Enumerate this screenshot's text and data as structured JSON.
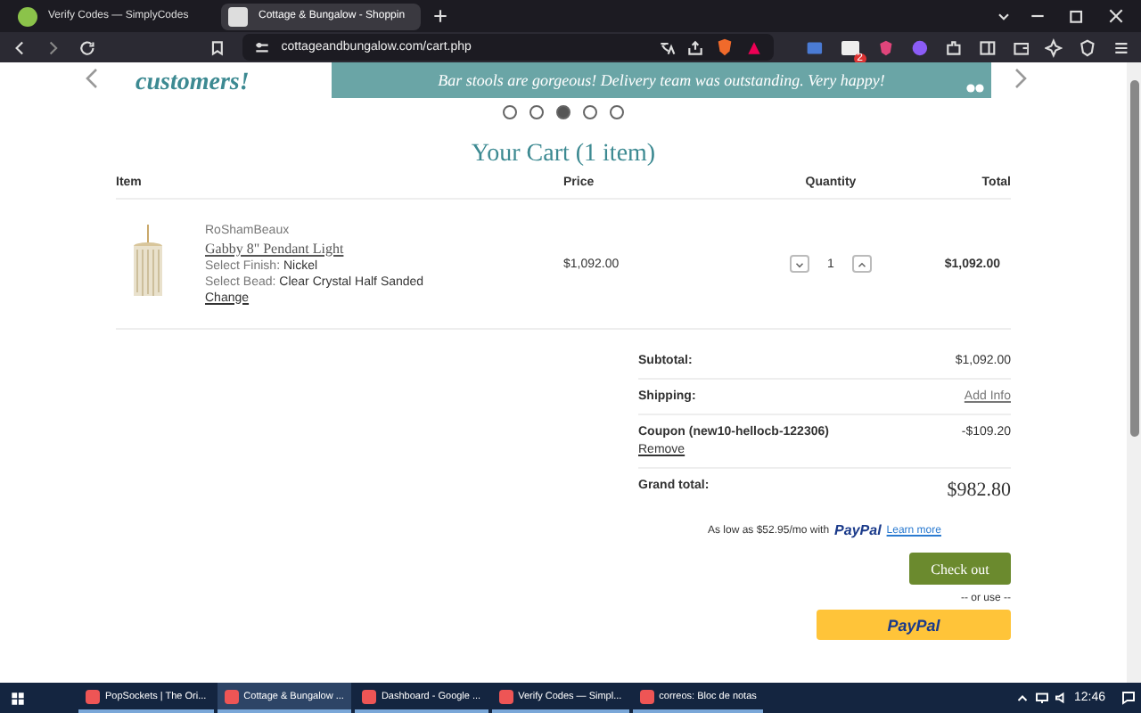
{
  "browser": {
    "tabs": [
      {
        "title": "Verify Codes — SimplyCodes",
        "selected": false
      },
      {
        "title": "Cottage & Bungalow - Shoppin",
        "selected": true
      }
    ],
    "url": "cottageandbungalow.com/cart.php",
    "extension_badge": "2"
  },
  "testimonial": {
    "tagline": "customers!",
    "quote": "Bar stools are gorgeous! Delivery team was outstanding. Very happy!"
  },
  "carousel_dots": [
    {
      "selected": false
    },
    {
      "selected": false
    },
    {
      "selected": true
    },
    {
      "selected": false
    },
    {
      "selected": false
    }
  ],
  "cart": {
    "title": "Your Cart (1 item)",
    "columns": [
      "Item",
      "Price",
      "Quantity",
      "Total"
    ],
    "items": [
      {
        "brand": "RoShamBeaux",
        "name": "Gabby 8\" Pendant Light",
        "options": [
          {
            "label": "Select Finish:",
            "value": "Nickel"
          },
          {
            "label": "Select Bead:",
            "value": "Clear Crystal Half Sanded"
          }
        ],
        "change": "Change",
        "price": "$1,092.00",
        "quantity": "1",
        "total": "$1,092.00"
      }
    ]
  },
  "summary": [
    {
      "kind": "plain",
      "label": "Subtotal:",
      "value": "$1,092.00"
    },
    {
      "kind": "link",
      "label": "Shipping:",
      "value": "Add Info"
    },
    {
      "kind": "coupon",
      "label": "Coupon (new10-hellocb-122306)",
      "value": "-$109.20",
      "action": "Remove"
    },
    {
      "kind": "grand",
      "label": "Grand total:",
      "value": "$982.80"
    }
  ],
  "financing": {
    "text": "As low as $52.95/mo with",
    "brand": "PayPal",
    "link": "Learn more"
  },
  "checkout": "Check out",
  "or_use": "-- or use --",
  "paypal_button": "PayPal",
  "taskbar": {
    "items": [
      {
        "label": "PopSockets | The Ori...",
        "selected": false
      },
      {
        "label": "Cottage & Bungalow ...",
        "selected": true
      },
      {
        "label": "Dashboard - Google ...",
        "selected": false
      },
      {
        "label": "Verify Codes — Simpl...",
        "selected": false
      },
      {
        "label": "correos: Bloc de notas",
        "selected": false
      }
    ],
    "time": "12:46"
  }
}
